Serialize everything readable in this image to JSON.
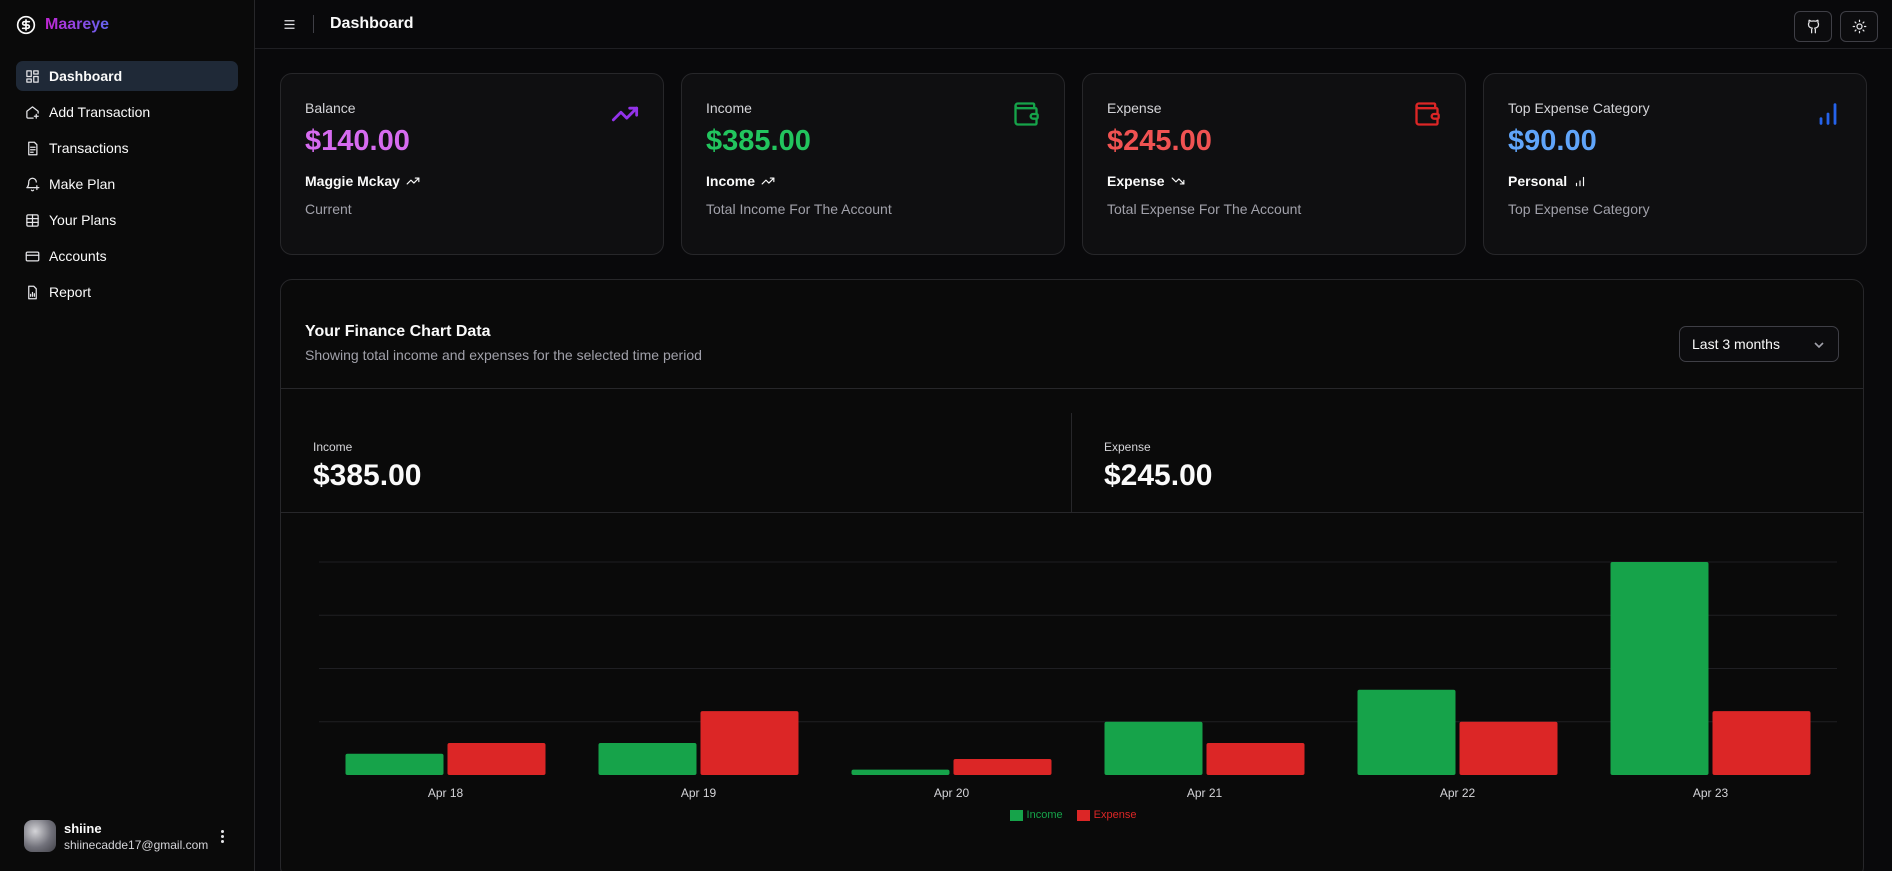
{
  "app": {
    "name": "Maareye"
  },
  "sidebar": {
    "items": [
      {
        "label": "Dashboard",
        "icon": "dashboard-icon",
        "active": true
      },
      {
        "label": "Add Transaction",
        "icon": "house-plus-icon"
      },
      {
        "label": "Transactions",
        "icon": "receipt-icon"
      },
      {
        "label": "Make Plan",
        "icon": "bell-plus-icon"
      },
      {
        "label": "Your Plans",
        "icon": "table-icon"
      },
      {
        "label": "Accounts",
        "icon": "credit-card-icon"
      },
      {
        "label": "Report",
        "icon": "report-icon"
      }
    ],
    "user": {
      "name": "shiine",
      "email": "shiinecadde17@gmail.com"
    }
  },
  "header": {
    "title": "Dashboard"
  },
  "cards": [
    {
      "label": "Balance",
      "value": "$140.00",
      "sub": "Maggie Mckay",
      "desc": "Current",
      "color": "#d946ef",
      "icon": "trending-up-icon"
    },
    {
      "label": "Income",
      "value": "$385.00",
      "sub": "Income",
      "desc": "Total Income For The Account",
      "color": "#22c55e",
      "icon": "wallet-icon"
    },
    {
      "label": "Expense",
      "value": "$245.00",
      "sub": "Expense",
      "desc": "Total Expense For The Account",
      "color": "#f05252",
      "icon": "wallet-icon"
    },
    {
      "label": "Top Expense Category",
      "value": "$90.00",
      "sub": "Personal",
      "desc": "Top Expense Category",
      "color": "#60a5fa",
      "icon": "bar-chart-icon"
    }
  ],
  "chart_card": {
    "title": "Your Finance Chart Data",
    "subtitle": "Showing total income and expenses for the selected time period",
    "range": "Last 3 months",
    "income_label": "Income",
    "income_total": "$385.00",
    "expense_label": "Expense",
    "expense_total": "$245.00"
  },
  "chart_data": {
    "type": "bar",
    "categories": [
      "Apr 18",
      "Apr 19",
      "Apr 20",
      "Apr 21",
      "Apr 22",
      "Apr 23"
    ],
    "series": [
      {
        "name": "Income",
        "color": "#16a34a",
        "values": [
          20,
          30,
          5,
          50,
          80,
          200
        ]
      },
      {
        "name": "Expense",
        "color": "#dc2626",
        "values": [
          30,
          60,
          15,
          30,
          50,
          60
        ]
      }
    ],
    "ylim": [
      0,
      200
    ],
    "grid": true,
    "legend": "bottom"
  }
}
